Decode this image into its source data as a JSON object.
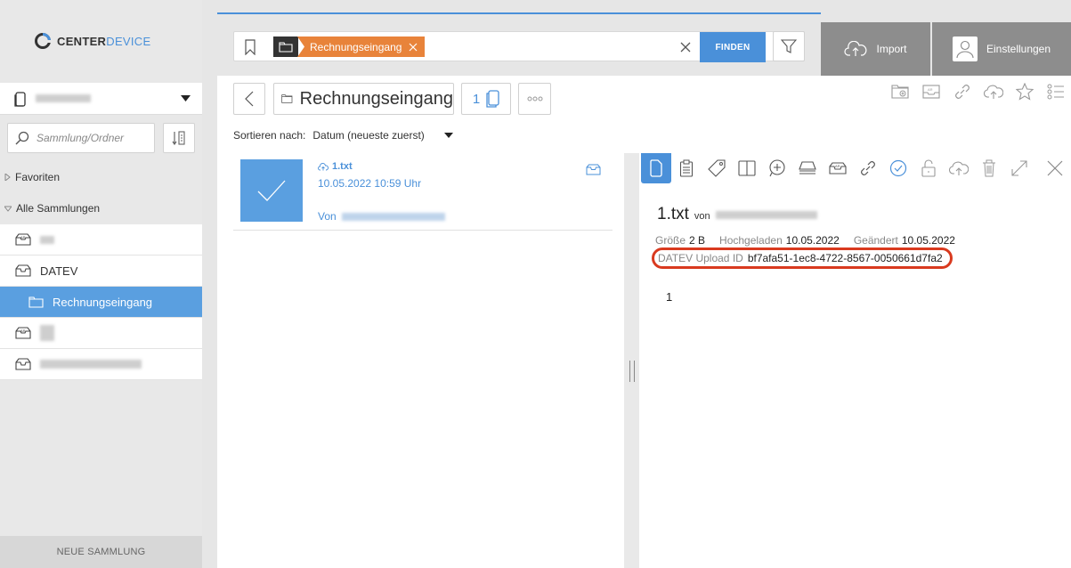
{
  "logo": {
    "brand_part1": "CENTER",
    "brand_part2": "DEVICE"
  },
  "sidebar": {
    "search_placeholder": "Sammlung/Ordner",
    "favorites_label": "Favoriten",
    "all_collections_label": "Alle Sammlungen",
    "collections": [
      {
        "label": "DATEV",
        "icon": "inbox-icon"
      },
      {
        "label": "Rechnungseingang",
        "icon": "folder-icon",
        "active": true
      }
    ],
    "new_collection_label": "NEUE SAMMLUNG"
  },
  "search": {
    "tag_label": "Rechnungseingang",
    "find_label": "FINDEN"
  },
  "header": {
    "import_label": "Import",
    "settings_label": "Einstellungen"
  },
  "breadcrumb": {
    "title": "Rechnungseingang",
    "count": "1"
  },
  "sort": {
    "label": "Sortieren nach:",
    "value": "Datum (neueste zuerst)"
  },
  "document": {
    "name": "1.txt",
    "date": "10.05.2022 10:59 Uhr",
    "from_label": "Von"
  },
  "viewer": {
    "title": "1.txt",
    "by_label": "von",
    "size_label": "Größe",
    "size_value": "2 B",
    "uploaded_label": "Hochgeladen",
    "uploaded_value": "10.05.2022",
    "changed_label": "Geändert",
    "changed_value": "10.05.2022",
    "datev_label": "DATEV Upload ID",
    "datev_value": "bf7afa51-1ec8-4722-8567-0050661d7fa2",
    "content": "1"
  },
  "colors": {
    "accent": "#4a90d9",
    "tag": "#e8833a",
    "highlight_ring": "#d93a1f",
    "header_button": "#8d8d8d"
  }
}
